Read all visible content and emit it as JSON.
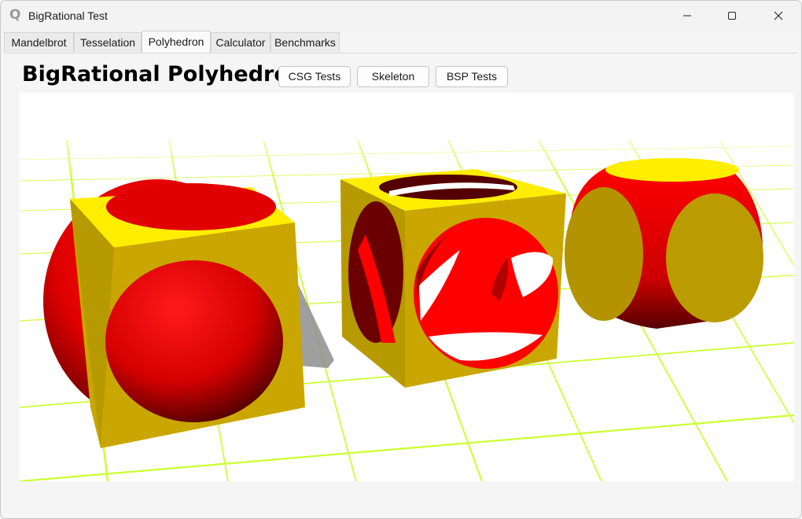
{
  "window": {
    "title": "BigRational Test",
    "app_icon_glyph": "Q",
    "app_icon": "qt-logo-icon"
  },
  "tabs": [
    {
      "label": "Mandelbrot",
      "active": false
    },
    {
      "label": "Tesselation",
      "active": false
    },
    {
      "label": "Polyhedron",
      "active": true
    },
    {
      "label": "Calculator",
      "active": false
    },
    {
      "label": "Benchmarks",
      "active": false
    }
  ],
  "main": {
    "heading": "BigRational Polyhedron",
    "buttons": {
      "csg": "CSG Tests",
      "skeleton": "Skeleton",
      "bsp": "BSP Tests"
    }
  },
  "viewport": {
    "scene": [
      "sphere-minus-cube",
      "cube-minus-sphere",
      "cube-intersect-sphere"
    ],
    "colors": {
      "red": "#ff0000",
      "yellow": "#ffe600",
      "gold": "#b39400",
      "grid": "#ccff33",
      "shadow": "#9a9a9a",
      "background": "#ffffff"
    }
  }
}
